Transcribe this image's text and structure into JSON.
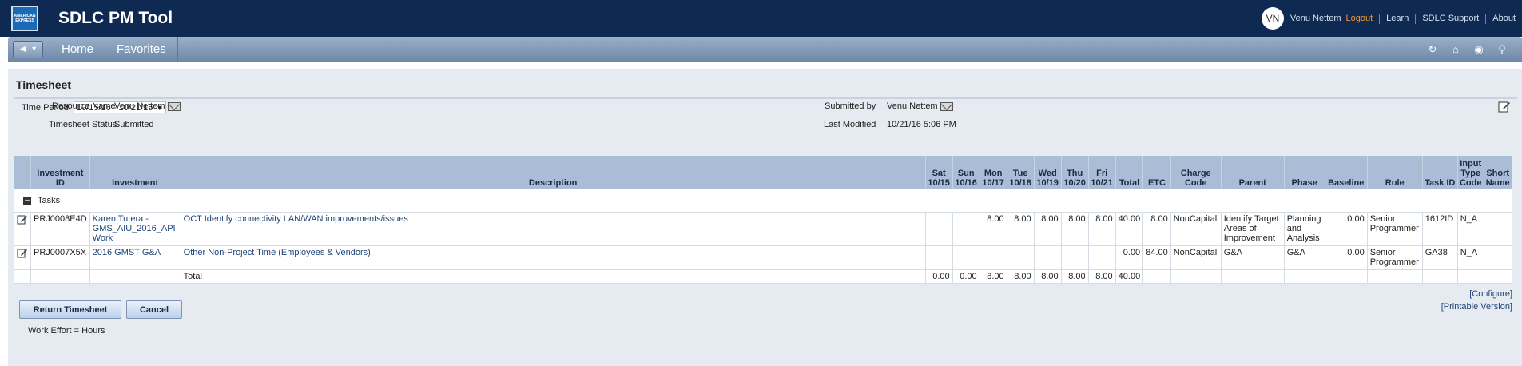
{
  "app": {
    "title": "SDLC PM Tool",
    "logo_text": "AMERICAN EXPRESS"
  },
  "user": {
    "initials": "VN",
    "name": "Venu Nettem"
  },
  "top_links": {
    "logout": "Logout",
    "learn": "Learn",
    "support": "SDLC Support",
    "about": "About"
  },
  "nav": {
    "tabs": [
      "Home",
      "Favorites"
    ],
    "icons": [
      "refresh-icon",
      "home-icon",
      "favorites-icon",
      "search-icon"
    ]
  },
  "page": {
    "title": "Timesheet"
  },
  "period": {
    "label": "Time Period:",
    "value": "10/15/16 - 10/21/16"
  },
  "details": {
    "resource_name_label": "Resource Name",
    "resource_name": "Venu Nettem",
    "status_label": "Timesheet Status",
    "status": "Submitted",
    "submitted_by_label": "Submitted by",
    "submitted_by": "Venu Nettem",
    "last_modified_label": "Last Modified",
    "last_modified": "10/21/16 5:06 PM"
  },
  "grid": {
    "headers": {
      "investment_id": "Investment ID",
      "investment": "Investment",
      "description": "Description",
      "sat": "Sat 10/15",
      "sun": "Sun 10/16",
      "mon": "Mon 10/17",
      "tue": "Tue 10/18",
      "wed": "Wed 10/19",
      "thu": "Thu 10/20",
      "fri": "Fri 10/21",
      "total": "Total",
      "etc": "ETC",
      "charge_code": "Charge Code",
      "parent": "Parent",
      "phase": "Phase",
      "baseline": "Baseline",
      "role": "Role",
      "task_id": "Task ID",
      "input_type_code": "Input Type Code",
      "short_name": "Short Name"
    },
    "group_label": "Tasks",
    "rows": [
      {
        "investment_id": "PRJ0008E4D",
        "investment": "Karen Tutera - GMS_AIU_2016_API Work",
        "description": "OCT Identify connectivity LAN/WAN improvements/issues",
        "sat": "",
        "sun": "",
        "mon": "8.00",
        "tue": "8.00",
        "wed": "8.00",
        "thu": "8.00",
        "fri": "8.00",
        "total": "40.00",
        "etc": "8.00",
        "charge_code": "NonCapital",
        "parent": "Identify Target Areas of Improvement",
        "phase": "Planning and Analysis",
        "baseline": "0.00",
        "role": "Senior Programmer",
        "task_id": "1612ID",
        "input_type_code": "N_A",
        "short_name": ""
      },
      {
        "investment_id": "PRJ0007X5X",
        "investment": "2016 GMST G&A",
        "description": "Other Non-Project Time (Employees & Vendors)",
        "sat": "",
        "sun": "",
        "mon": "",
        "tue": "",
        "wed": "",
        "thu": "",
        "fri": "",
        "total": "0.00",
        "etc": "84.00",
        "charge_code": "NonCapital",
        "parent": "G&A",
        "phase": "G&A",
        "baseline": "0.00",
        "role": "Senior Programmer",
        "task_id": "GA38",
        "input_type_code": "N_A",
        "short_name": ""
      }
    ],
    "total_row": {
      "label": "Total",
      "sat": "0.00",
      "sun": "0.00",
      "mon": "8.00",
      "tue": "8.00",
      "wed": "8.00",
      "thu": "8.00",
      "fri": "8.00",
      "total": "40.00"
    }
  },
  "links": {
    "configure": "[Configure]",
    "printable": "[Printable Version]"
  },
  "buttons": {
    "return": "Return Timesheet",
    "cancel": "Cancel"
  },
  "footer": {
    "work_effort": "Work Effort = Hours"
  },
  "colors": {
    "topbar": "#0e2a52",
    "accent_orange": "#f3952d",
    "header_bg": "#a9bed6",
    "content_bg": "#e6eaf1"
  }
}
